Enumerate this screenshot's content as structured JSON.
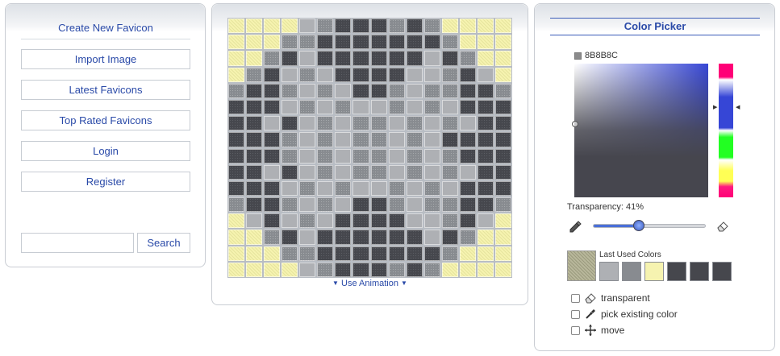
{
  "nav": {
    "create": "Create New Favicon",
    "import": "Import Image",
    "latest": "Latest Favicons",
    "top_rated": "Top Rated Favicons",
    "login": "Login",
    "register": "Register"
  },
  "search": {
    "placeholder": "",
    "value": "",
    "button": "Search"
  },
  "editor": {
    "animation_label": "Use Animation",
    "pixels": [
      "YYYYLMDDDMDMYYYY",
      "YYYMMDDDDDDDMYYY",
      "YYMDLDDDDDDLDMYY",
      "YMDLMLDDDDLLMDLY",
      "MDDMLMLDDMLMMDDM",
      "DDDLMLMLLMLMLDDD",
      "DDLDLMLMMLMLMLDD",
      "DDDMLMLMMLMLDDDD",
      "DDDMLMLMMLMLMDDD",
      "DDLDLMLMMLMLMLDD",
      "DDDLMLMLLMLMLDDD",
      "MDDMLMLDDMLMMDDM",
      "YLDLMLDDDDLLMDLY",
      "YYMDLDDDDDDLDMYY",
      "YYYMMDDDDDDDMYYY",
      "YYYYLMDDDMDMYYYY"
    ],
    "palette": {
      "Y": "#f6f3b0",
      "L": "#aeb0b4",
      "M": "#888b90",
      "D": "#46474d"
    }
  },
  "picker": {
    "title": "Color Picker",
    "hex": "8B8B8C",
    "transparency_label": "Transparency: 41%",
    "transparency": 0.41,
    "last_used_label": "Last Used Colors",
    "last_used_colors": [
      "#aeb0b4",
      "#888b90",
      "#f6f3b0",
      "#46474d",
      "#46474d",
      "#46474d"
    ],
    "options": {
      "transparent": "transparent",
      "pick": "pick existing color",
      "move": "move"
    }
  }
}
